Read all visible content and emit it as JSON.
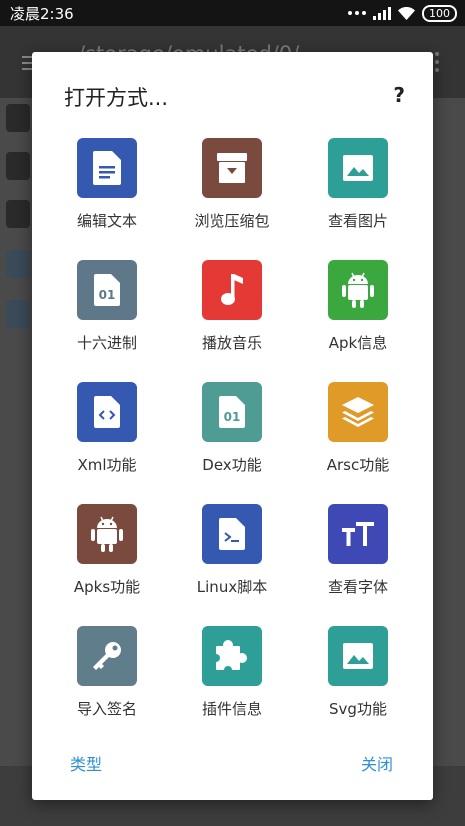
{
  "status_bar": {
    "time": "凌晨2:36",
    "battery": "100"
  },
  "background": {
    "path": "/storage/emulated/0/"
  },
  "dialog": {
    "title": "打开方式...",
    "help": "?",
    "accent_color": "#2f8fd8",
    "items": [
      {
        "label": "编辑文本",
        "icon": "document-icon",
        "color": "#3559b0"
      },
      {
        "label": "浏览压缩包",
        "icon": "archive-icon",
        "color": "#7a4a3e"
      },
      {
        "label": "查看图片",
        "icon": "image-icon",
        "color": "#2d9f96"
      },
      {
        "label": "十六进制",
        "icon": "binary-file-icon",
        "color": "#5f7889"
      },
      {
        "label": "播放音乐",
        "icon": "music-note-icon",
        "color": "#e53935"
      },
      {
        "label": "Apk信息",
        "icon": "android-icon",
        "color": "#3aa83f"
      },
      {
        "label": "Xml功能",
        "icon": "code-file-icon",
        "color": "#3559b0"
      },
      {
        "label": "Dex功能",
        "icon": "binary-file-icon",
        "color": "#4f9c95"
      },
      {
        "label": "Arsc功能",
        "icon": "layers-icon",
        "color": "#df9a28"
      },
      {
        "label": "Apks功能",
        "icon": "android-icon",
        "color": "#7a4a3e"
      },
      {
        "label": "Linux脚本",
        "icon": "terminal-file-icon",
        "color": "#3559b0"
      },
      {
        "label": "查看字体",
        "icon": "font-icon",
        "color": "#3f49b5"
      },
      {
        "label": "导入签名",
        "icon": "key-icon",
        "color": "#607d8b"
      },
      {
        "label": "插件信息",
        "icon": "puzzle-icon",
        "color": "#2d9f96"
      },
      {
        "label": "Svg功能",
        "icon": "image-icon",
        "color": "#2d9f96"
      }
    ],
    "type_button": "类型",
    "close_button": "关闭"
  }
}
